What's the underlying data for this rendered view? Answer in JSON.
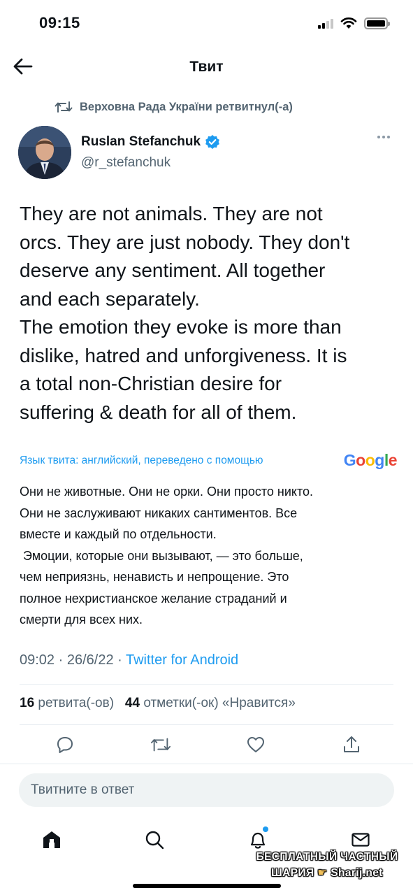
{
  "status_bar": {
    "time": "09:15"
  },
  "header": {
    "title": "Твит"
  },
  "retweet": {
    "label": "Верховна Рада України ретвитнул(-а)"
  },
  "author": {
    "name": "Ruslan Stefanchuk",
    "handle": "@r_stefanchuk",
    "verified": true
  },
  "tweet": {
    "lines": [
      "They are not animals.  They are not",
      "orcs.  They are just nobody.  They don't",
      "deserve any sentiment.  All together",
      "and each separately.",
      "The emotion they evoke is more than",
      "dislike, hatred and unforgiveness.  It is",
      "a total non-Christian desire for",
      "suffering & death for all of them."
    ]
  },
  "translation": {
    "note": "Язык твита: английский, переведено с помощью",
    "provider": "Google",
    "lines": [
      "Они не животные. Они не орки. Они просто никто.",
      "Они не заслуживают никаких сантиментов. Все",
      "вместе и каждый по отдельности.",
      " Эмоции, которые они вызывают, — это больше,",
      "чем неприязнь, ненависть и непрощение. Это",
      "полное нехристианское желание страданий и",
      "смерти для всех них."
    ]
  },
  "meta": {
    "time": "09:02",
    "date": "26/6/22",
    "source": "Twitter for Android"
  },
  "stats": {
    "retweets": "16",
    "retweets_label": "ретвита(-ов)",
    "likes": "44",
    "likes_label": "отметки(-ок) «Нравится»"
  },
  "reply": {
    "placeholder": "Твитните в ответ"
  },
  "watermark": {
    "line1": "БЕСПЛАТНЫЙ ЧАСТНЫЙ",
    "line2_left": "ШАРИЯ",
    "line2_right": "Sharij.net"
  },
  "colors": {
    "accent": "#1d9bf0",
    "text": "#0f1419",
    "muted": "#536471"
  },
  "icons": {
    "back": "arrow-left-icon",
    "retweet": "retweet-icon",
    "verified": "verified-badge-icon",
    "more": "more-horizontal-icon",
    "reply": "comment-icon",
    "like": "heart-icon",
    "share": "share-icon",
    "home": "home-icon",
    "search": "search-icon",
    "notifications": "bell-icon",
    "messages": "mail-icon"
  }
}
